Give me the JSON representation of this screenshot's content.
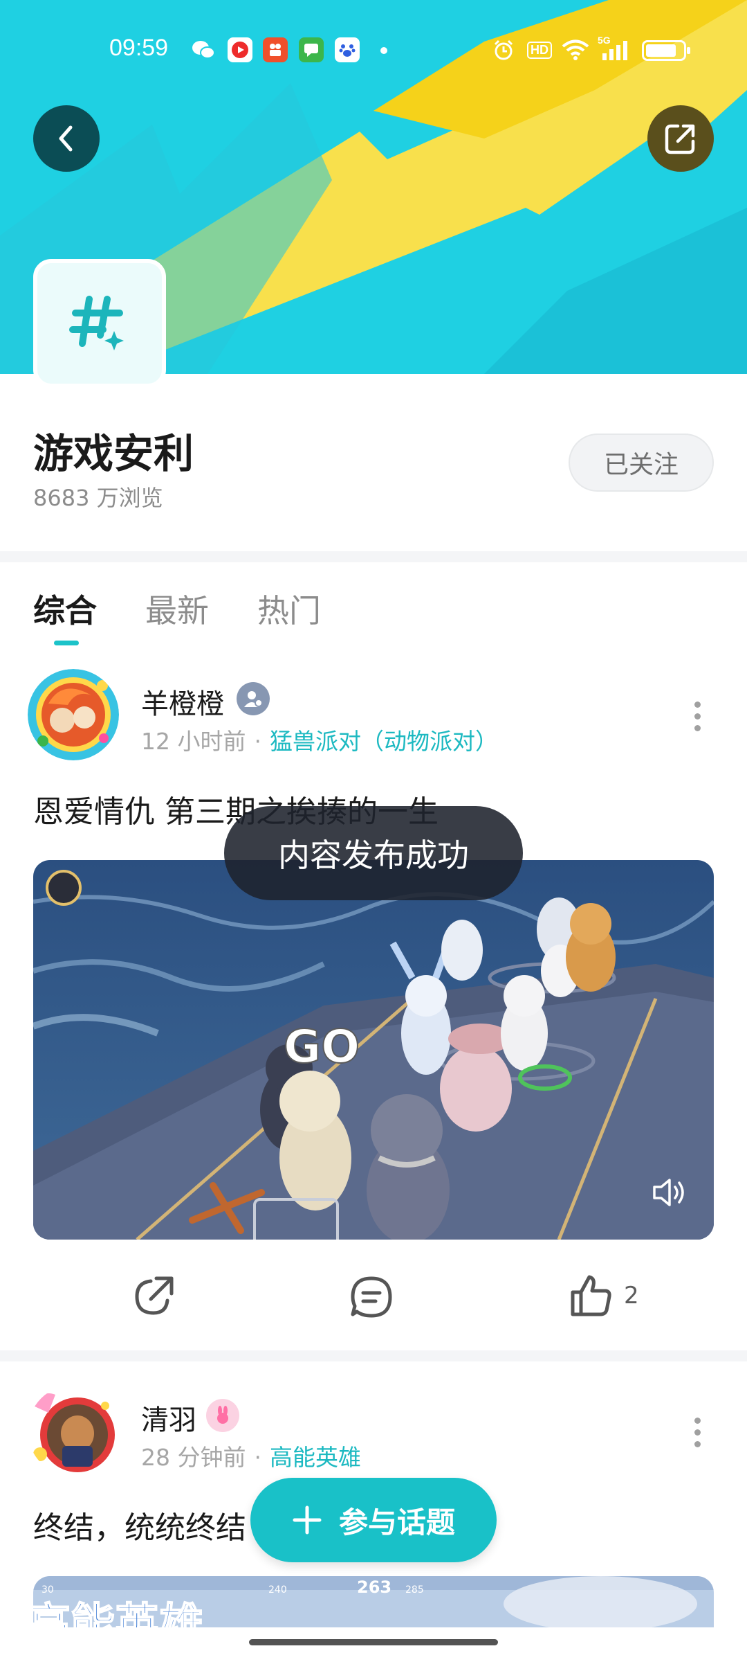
{
  "status_bar": {
    "time": "09:59",
    "apps": [
      "wechat-icon",
      "video-app-icon",
      "kuaishou-icon",
      "messages-icon",
      "baidu-icon"
    ],
    "icons": [
      "alarm-icon",
      "hd-icon",
      "wifi-icon",
      "signal-5g-icon",
      "battery-icon"
    ],
    "hd_label": "HD",
    "network_label": "5G",
    "battery_level": 0.84
  },
  "header": {
    "title": "游戏安利",
    "views": "8683 万浏览",
    "follow_label": "已关注",
    "colors": {
      "banner_cyan": "#1fd0e2",
      "banner_yellow": "#f7df4a",
      "accent": "#1cc3c9"
    }
  },
  "tabs": [
    {
      "label": "综合",
      "active": true
    },
    {
      "label": "最新",
      "active": false
    },
    {
      "label": "热门",
      "active": false
    }
  ],
  "posts": [
    {
      "author": "羊橙橙",
      "time": "12 小时前",
      "separator": "·",
      "topic": "猛兽派对（动物派对）",
      "text": "恩爱情仇 第三期之挨揍的一生",
      "like_count": "2",
      "overlay_text": "GO"
    },
    {
      "author": "清羽",
      "time": "28 分钟前",
      "separator": "·",
      "topic": "高能英雄",
      "text": "终结，统统终结",
      "thumb_text": "高能英雄",
      "hud_numbers": [
        "240",
        "263",
        "285",
        "30"
      ]
    }
  ],
  "toast": "内容发布成功",
  "fab_label": "参与话题"
}
